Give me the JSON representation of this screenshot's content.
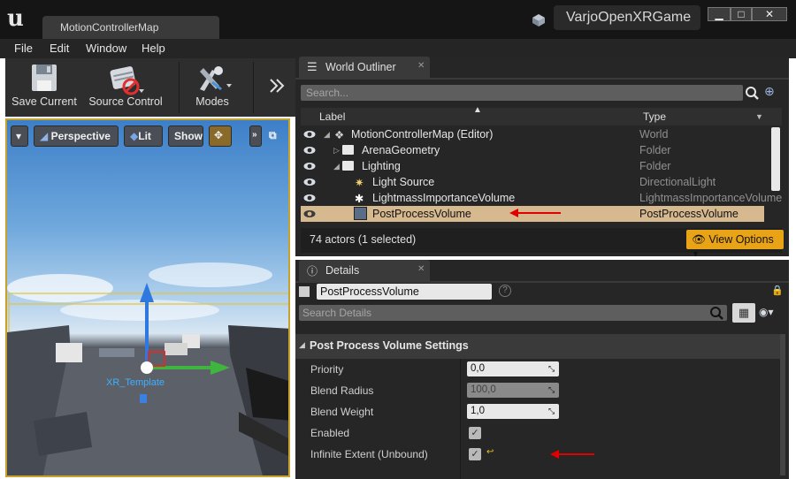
{
  "app": {
    "map_tab": "MotionControllerMap",
    "project_name": "VarjoOpenXRGame"
  },
  "menu": [
    "File",
    "Edit",
    "Window",
    "Help"
  ],
  "toolbar": {
    "save_current": "Save Current",
    "source_control": "Source Control",
    "modes": "Modes"
  },
  "viewport": {
    "perspective": "Perspective",
    "lit": "Lit",
    "show": "Show",
    "actor_label": "XR_Template"
  },
  "outliner": {
    "tab_title": "World Outliner",
    "search_placeholder": "Search...",
    "col_label": "Label",
    "col_type": "Type",
    "rows": [
      {
        "label": "MotionControllerMap (Editor)",
        "type": "World"
      },
      {
        "label": "ArenaGeometry",
        "type": "Folder"
      },
      {
        "label": "Lighting",
        "type": "Folder"
      },
      {
        "label": "Light Source",
        "type": "DirectionalLight"
      },
      {
        "label": "LightmassImportanceVolume",
        "type": "LightmassImportanceVolume"
      },
      {
        "label": "PostProcessVolume",
        "type": "PostProcessVolume"
      }
    ],
    "footer_count": "74 actors (1 selected)",
    "view_options": "View Options"
  },
  "details": {
    "tab_title": "Details",
    "object_name": "PostProcessVolume",
    "search_placeholder": "Search Details",
    "section": "Post Process Volume Settings",
    "properties": [
      {
        "name": "Priority",
        "value": "0,0"
      },
      {
        "name": "Blend Radius",
        "value": "100,0"
      },
      {
        "name": "Blend Weight",
        "value": "1,0"
      },
      {
        "name": "Enabled",
        "value": "✓"
      },
      {
        "name": "Infinite Extent (Unbound)",
        "value": "✓"
      }
    ]
  },
  "colors": {
    "selection": "#d6b98e",
    "accent_orange": "#e8a317",
    "annotation_arrow": "#e00000"
  }
}
